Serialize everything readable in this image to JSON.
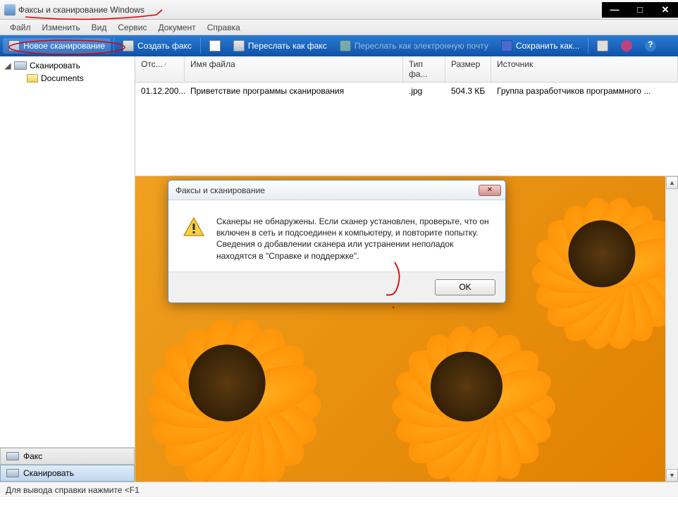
{
  "window": {
    "title": "Факсы и сканирование Windows"
  },
  "menu": {
    "file": "Файл",
    "edit": "Изменить",
    "view": "Вид",
    "tools": "Сервис",
    "document": "Документ",
    "help": "Справка"
  },
  "toolbar": {
    "new_scan": "Новое сканирование",
    "new_fax": "Создать факс",
    "forward_fax": "Переслать как факс",
    "forward_email": "Переслать как электронную почту",
    "save_as": "Сохранить как..."
  },
  "sidebar": {
    "scan_root": "Сканировать",
    "documents": "Documents"
  },
  "bottom_tabs": {
    "fax": "Факс",
    "scan": "Сканировать"
  },
  "columns": {
    "sent": "Отс...",
    "filename": "Имя файла",
    "type": "Тип фа...",
    "size": "Размер",
    "source": "Источник"
  },
  "rows": [
    {
      "sent": "01.12.200...",
      "filename": "Приветствие программы сканирования",
      "type": ".jpg",
      "size": "504.3 КБ",
      "source": "Группа разработчиков программного ..."
    }
  ],
  "dialog": {
    "title": "Факсы и сканирование",
    "body_l1": "Сканеры не обнаружены. Если сканер установлен, проверьте, что он включен в сеть и подсоединен к компьютеру, и повторите попытку.",
    "body_l2": "Сведения о добавлении сканера или устранении неполадок находятся в \"Справке и поддержке\".",
    "ok": "OK"
  },
  "status": "Для вывода справки нажмите <F1"
}
